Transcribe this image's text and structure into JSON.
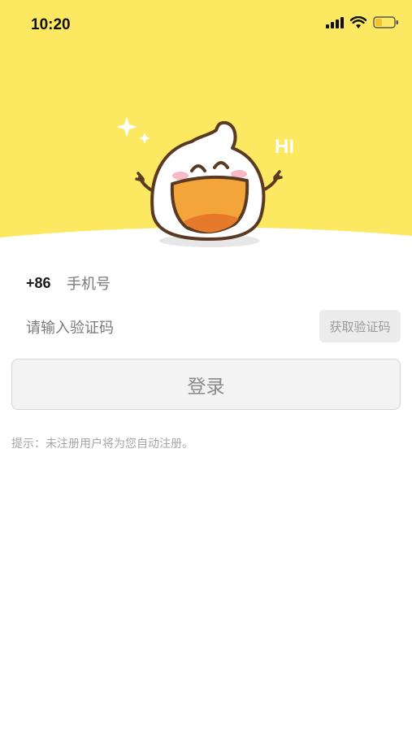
{
  "status_bar": {
    "time": "10:20",
    "signal_icon": "signal-bars-icon",
    "wifi_icon": "wifi-icon",
    "battery_icon": "battery-icon"
  },
  "hero": {
    "background_color": "#FDE862",
    "illustration": "mascot-illustration",
    "greeting": "HI"
  },
  "form": {
    "country_code": "+86",
    "phone_placeholder": "手机号",
    "code_placeholder": "请输入验证码",
    "get_code_label": "获取验证码",
    "login_label": "登录"
  },
  "hint": "提示：未注册用户将为您自动注册。"
}
